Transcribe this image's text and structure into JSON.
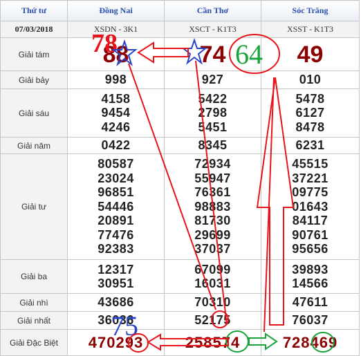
{
  "header": {
    "col_label": "Thứ tư",
    "provinces": [
      "Đồng Nai",
      "Cần Thơ",
      "Sóc Trăng"
    ]
  },
  "subheader": {
    "date": "07/03/2018",
    "codes": [
      "XSDN - 3K1",
      "XSCT - K1T3",
      "XSST - K1T3"
    ]
  },
  "prizes": {
    "g8": {
      "label": "Giải tám",
      "values": [
        "88",
        "74",
        "49"
      ]
    },
    "g7": {
      "label": "Giải bảy",
      "values": [
        "998",
        "927",
        "010"
      ]
    },
    "g6": {
      "label": "Giải sáu",
      "values": [
        [
          "4158",
          "9454",
          "4246"
        ],
        [
          "5422",
          "2798",
          "5451"
        ],
        [
          "5478",
          "6127",
          "8478"
        ]
      ]
    },
    "g5": {
      "label": "Giải năm",
      "values": [
        "0422",
        "8345",
        "6231"
      ]
    },
    "g4": {
      "label": "Giải tư",
      "values": [
        [
          "80587",
          "23024",
          "96851",
          "54446",
          "20891",
          "77476",
          "92383"
        ],
        [
          "72934",
          "55947",
          "76361",
          "98883",
          "81730",
          "29699",
          "37037"
        ],
        [
          "45515",
          "37221",
          "09775",
          "01643",
          "84117",
          "90761",
          "95656"
        ]
      ]
    },
    "g3": {
      "label": "Giải ba",
      "values": [
        [
          "12317",
          "30951"
        ],
        [
          "67099",
          "16031"
        ],
        [
          "39893",
          "14566"
        ]
      ]
    },
    "g2": {
      "label": "Giải nhì",
      "values": [
        "43686",
        "70310",
        "47611"
      ]
    },
    "g1": {
      "label": "Giải nhất",
      "values": [
        "36036",
        "52175",
        "76037"
      ]
    },
    "db": {
      "label": "Giải Đặc Biệt",
      "values": [
        "470293",
        "258574",
        "728469"
      ]
    }
  },
  "annotations": {
    "red_78": "78",
    "green_64": "64",
    "blue_75": "75",
    "colors": {
      "red": "#e8141c",
      "green": "#1aa33a",
      "blue": "#2a44c8"
    }
  }
}
